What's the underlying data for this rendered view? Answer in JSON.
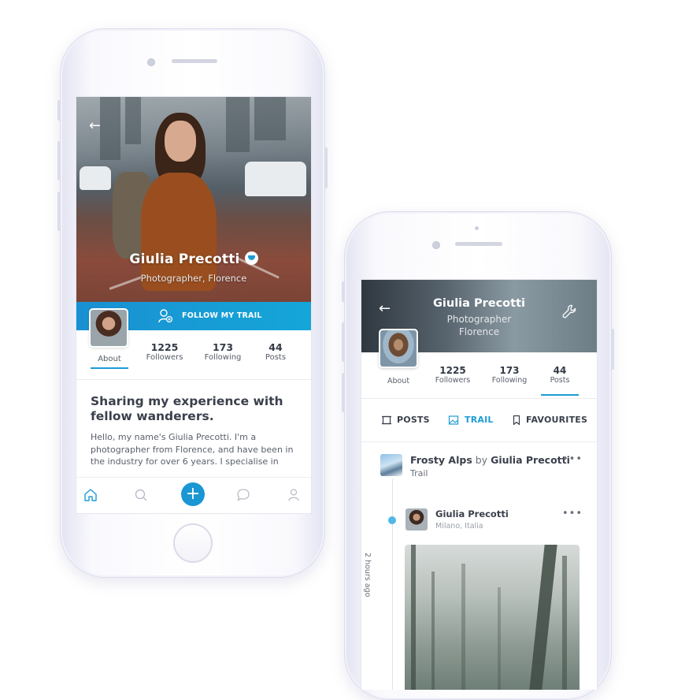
{
  "profile_screen": {
    "name": "Giulia Precotti",
    "subtitle": "Photographer, Florence",
    "follow_label": "FOLLOW MY TRAIL",
    "tabs": {
      "about": "About",
      "followers_count": "1225",
      "followers_label": "Followers",
      "following_count": "173",
      "following_label": "Following",
      "posts_count": "44",
      "posts_label": "Posts"
    },
    "headline": "Sharing my experience with fellow wanderers.",
    "bio": "Hello, my name's Giulia Precotti. I'm a photographer from Florence, and have been in the industry for over 6 years. I specialise in",
    "nav_icons": [
      "home-icon",
      "search-icon",
      "add-icon",
      "chat-icon",
      "user-icon"
    ]
  },
  "trail_screen": {
    "name": "Giulia Precotti",
    "subtitle": "Photographer Florence",
    "tabs": {
      "about": "About",
      "followers_count": "1225",
      "followers_label": "Followers",
      "following_count": "173",
      "following_label": "Following",
      "posts_count": "44",
      "posts_label": "Posts"
    },
    "filters": {
      "posts": "POSTS",
      "trail": "TRAIL",
      "favourites": "FAVOURITES"
    },
    "trail_item": {
      "title": "Frosty Alps",
      "by": "by",
      "author": "Giulia Precotti",
      "type": "Trail",
      "time": "2 hours ago"
    },
    "post": {
      "author": "Giulia Precotti",
      "location": "Milano, Italia"
    }
  },
  "colors": {
    "accent": "#1e9cd6",
    "text": "#3a3f4b",
    "muted": "#6a6f7b"
  }
}
